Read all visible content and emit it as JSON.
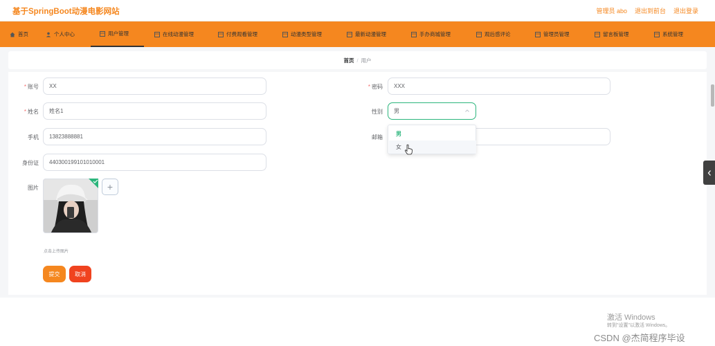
{
  "header": {
    "site_title": "基于SpringBoot动漫电影网站",
    "admin_label": "管理员 abo",
    "back_label": "退出到前台",
    "logout_label": "退出登录"
  },
  "nav": {
    "items": [
      {
        "label": "首页",
        "icon": "home-icon"
      },
      {
        "label": "个人中心",
        "icon": "user-icon"
      },
      {
        "label": "用户管理",
        "icon": "grid-icon"
      },
      {
        "label": "在线动漫管理",
        "icon": "grid-icon"
      },
      {
        "label": "付费观看管理",
        "icon": "grid-icon"
      },
      {
        "label": "动漫类型管理",
        "icon": "grid-icon"
      },
      {
        "label": "最新动漫管理",
        "icon": "grid-icon"
      },
      {
        "label": "手办商城管理",
        "icon": "grid-icon"
      },
      {
        "label": "观后感评论",
        "icon": "grid-icon"
      },
      {
        "label": "管理员管理",
        "icon": "grid-icon"
      },
      {
        "label": "留言板管理",
        "icon": "grid-icon"
      },
      {
        "label": "系统管理",
        "icon": "grid-icon"
      }
    ],
    "active_index": 2
  },
  "breadcrumb": {
    "home": "首页",
    "sep": "/",
    "current": "用户"
  },
  "form": {
    "account": {
      "label": "账号",
      "value": "XX"
    },
    "password": {
      "label": "密码",
      "value": "XXX"
    },
    "name": {
      "label": "姓名",
      "value": "姓名1"
    },
    "gender": {
      "label": "性别",
      "value": "男",
      "options": [
        "男",
        "女"
      ]
    },
    "phone": {
      "label": "手机",
      "value": "13823888881"
    },
    "email": {
      "label": "邮箱",
      "value": ""
    },
    "idcard": {
      "label": "身份证",
      "value": "440300199101010001"
    },
    "image": {
      "label": "图片",
      "add_symbol": "+",
      "tip": "点击上传图片"
    },
    "submit_label": "提交",
    "cancel_label": "取消"
  },
  "watermark": {
    "line1": "激活 Windows",
    "line2": "转到\"设置\"以激活 Windows。",
    "line3": "CSDN @杰简程序毕设"
  },
  "colors": {
    "accent": "#f5871f",
    "cancel": "#f0431f",
    "success": "#2bb57c"
  }
}
